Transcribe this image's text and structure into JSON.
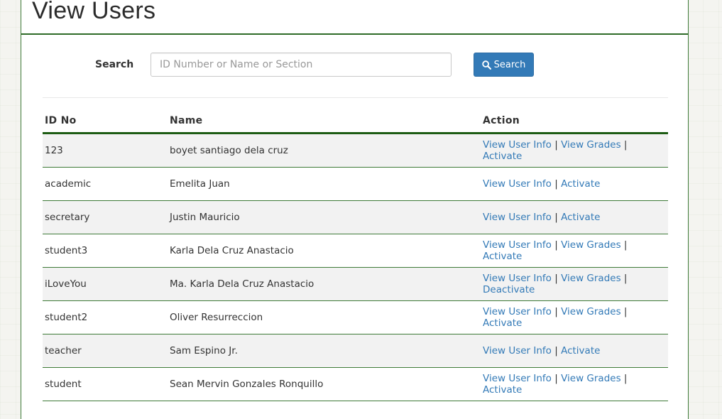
{
  "page_title": "View Users",
  "search": {
    "label": "Search",
    "placeholder": "ID Number or Name or Section",
    "button_label": "Search",
    "button_icon": "search-icon"
  },
  "table": {
    "columns": [
      "ID No",
      "Name",
      "Action"
    ],
    "rows": [
      {
        "id": "123",
        "name": "boyet santiago dela cruz",
        "actions": [
          "View User Info",
          "View Grades",
          "Activate"
        ]
      },
      {
        "id": "academic",
        "name": "Emelita Juan",
        "actions": [
          "View User Info",
          "Activate"
        ]
      },
      {
        "id": "secretary",
        "name": "Justin Mauricio",
        "actions": [
          "View User Info",
          "Activate"
        ]
      },
      {
        "id": "student3",
        "name": "Karla Dela Cruz Anastacio",
        "actions": [
          "View User Info",
          "View Grades",
          "Activate"
        ]
      },
      {
        "id": "iLoveYou",
        "name": "Ma. Karla Dela Cruz Anastacio",
        "actions": [
          "View User Info",
          "View Grades",
          "Deactivate"
        ]
      },
      {
        "id": "student2",
        "name": "Oliver Resurreccion",
        "actions": [
          "View User Info",
          "View Grades",
          "Activate"
        ]
      },
      {
        "id": "teacher",
        "name": "Sam Espino Jr.",
        "actions": [
          "View User Info",
          "Activate"
        ]
      },
      {
        "id": "student",
        "name": "Sean Mervin Gonzales Ronquillo",
        "actions": [
          "View User Info",
          "View Grades",
          "Activate"
        ]
      }
    ]
  },
  "colors": {
    "accent": "#337ab7",
    "border_green": "#3e7a37",
    "header_rule": "#1d5c13"
  }
}
